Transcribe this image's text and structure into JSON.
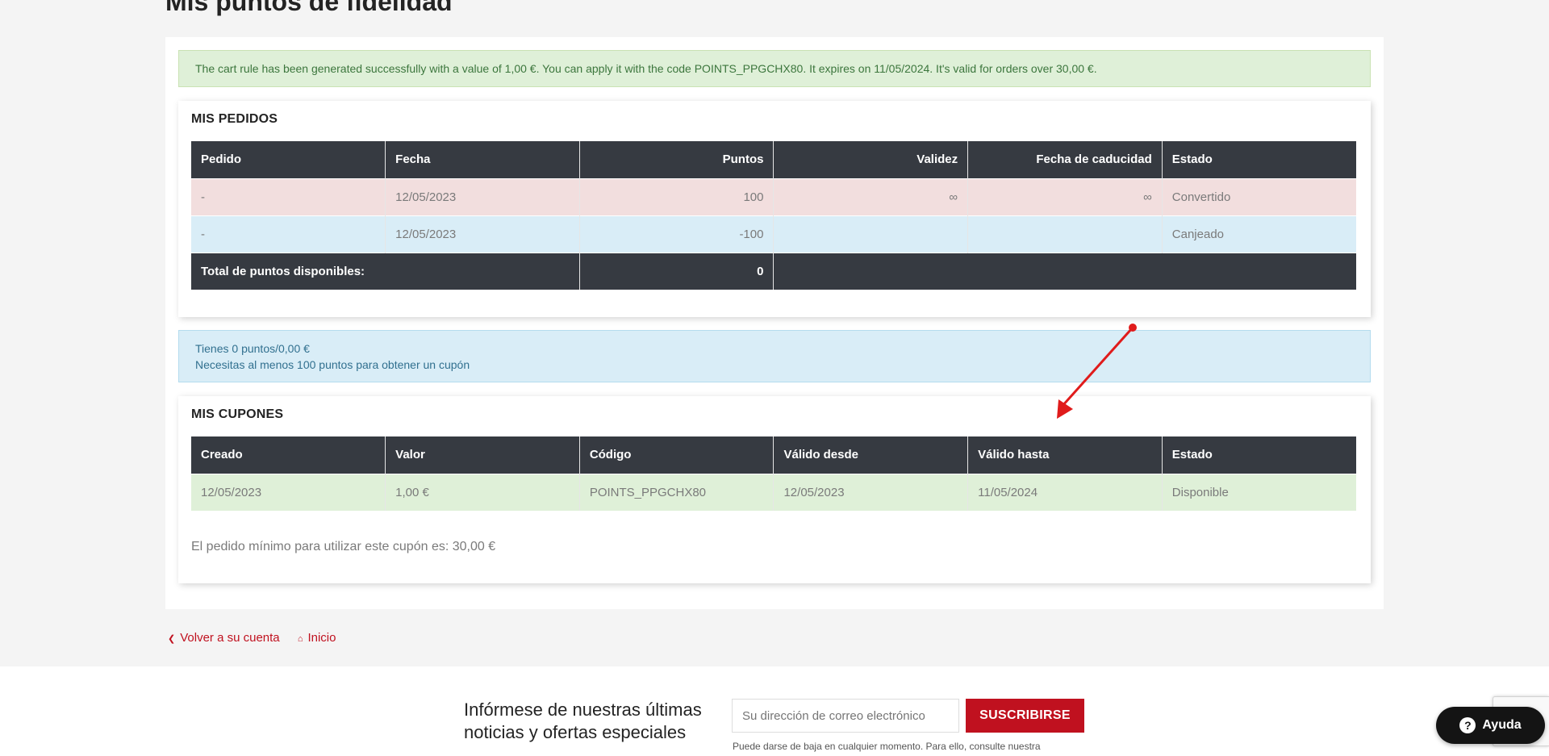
{
  "page": {
    "title": "Mis puntos de fidelidad"
  },
  "alert_success": "The cart rule has been generated successfully with a value of 1,00 €. You can apply it with the code POINTS_PPGCHX80. It expires on 11/05/2024. It's valid for orders over 30,00 €.",
  "orders": {
    "heading": "MIS PEDIDOS",
    "columns": [
      "Pedido",
      "Fecha",
      "Puntos",
      "Validez",
      "Fecha de caducidad",
      "Estado"
    ],
    "rows": [
      {
        "pedido": "-",
        "fecha": "12/05/2023",
        "puntos": "100",
        "validez": "∞",
        "caducidad": "∞",
        "estado": "Convertido"
      },
      {
        "pedido": "-",
        "fecha": "12/05/2023",
        "puntos": "-100",
        "validez": "",
        "caducidad": "",
        "estado": "Canjeado"
      }
    ],
    "total_label": "Total de puntos disponibles:",
    "total_value": "0"
  },
  "info_alert": {
    "line1": "Tienes 0 puntos/0,00 €",
    "line2": "Necesitas al menos 100 puntos para obtener un cupón"
  },
  "coupons": {
    "heading": "MIS CUPONES",
    "columns": [
      "Creado",
      "Valor",
      "Código",
      "Válido desde",
      "Válido hasta",
      "Estado"
    ],
    "rows": [
      {
        "creado": "12/05/2023",
        "valor": "1,00 €",
        "codigo": "POINTS_PPGCHX80",
        "desde": "12/05/2023",
        "hasta": "11/05/2024",
        "estado": "Disponible"
      }
    ],
    "min_order_note": "El pedido mínimo para utilizar este cupón es: 30,00 €"
  },
  "links": {
    "back_account": "Volver a su cuenta",
    "home": "Inicio"
  },
  "newsletter": {
    "title": "Infórmese de nuestras últimas noticias y ofertas especiales",
    "placeholder": "Su dirección de correo electrónico",
    "button": "SUSCRIBIRSE",
    "note": "Puede darse de baja en cualquier momento. Para ello, consulte nuestra"
  },
  "help": {
    "label": "Ayuda"
  },
  "colors": {
    "accent": "#c0111f",
    "header_dark": "#363a41",
    "annotation_arrow": "#e01b1b"
  }
}
